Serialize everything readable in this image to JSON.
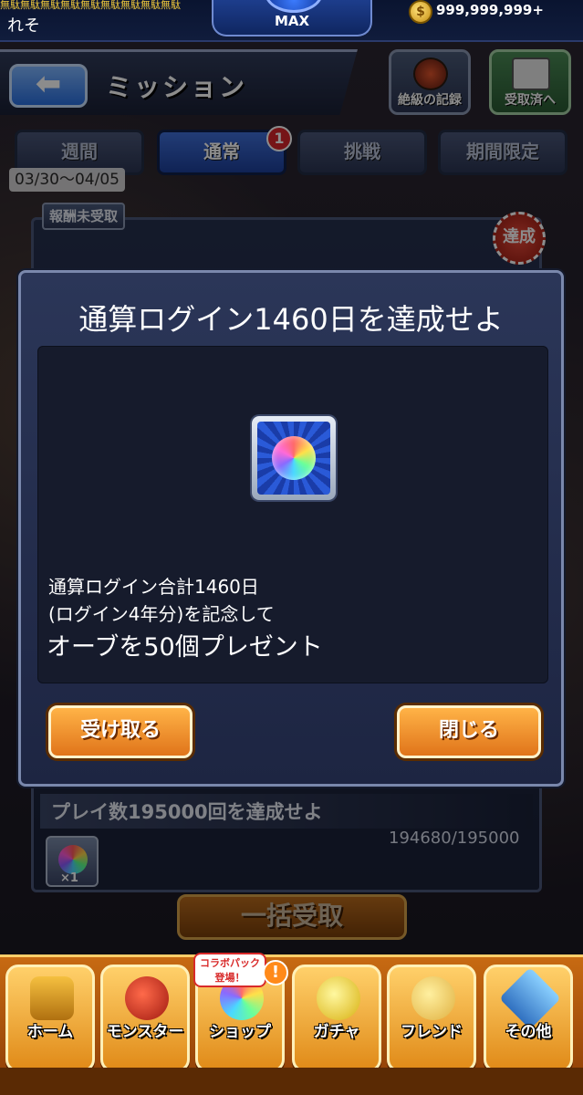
{
  "top_bar": {
    "title_strip": "無駄無駄無駄無駄無駄無駄無駄無駄無駄",
    "player_name": "れそ",
    "rank_label": "MAX",
    "coin_glyph": "$",
    "coins": "999,999,999+"
  },
  "header": {
    "back_glyph": "⬅",
    "title": "ミッション",
    "records_button": "絶級の記録",
    "received_button": "受取済へ"
  },
  "tabs": [
    {
      "label": "週間"
    },
    {
      "label": "通常",
      "badge": "1"
    },
    {
      "label": "挑戦"
    },
    {
      "label": "期間限定"
    }
  ],
  "date_range": "03/30〜04/05",
  "list": {
    "unclaimed_tag": "報酬未受取",
    "achieved_stamp": "達成",
    "mission_title": "プレイ数195000回を達成せよ",
    "mission_progress": "194680/195000",
    "reward_qty": "×1",
    "bulk_claim": "一括受取"
  },
  "modal": {
    "title": "通算ログイン1460日を達成せよ",
    "reward_icon": "rainbow-orb",
    "desc_line1": "通算ログイン合計1460日",
    "desc_line2": "(ログイン4年分)を記念して",
    "desc_line3": "オーブを50個プレゼント",
    "receive_button": "受け取る",
    "close_button": "閉じる"
  },
  "nav": {
    "items": [
      {
        "label": "ホーム"
      },
      {
        "label": "モンスター"
      },
      {
        "label": "ショップ"
      },
      {
        "label": "ガチャ"
      },
      {
        "label": "フレンド"
      },
      {
        "label": "その他"
      }
    ],
    "shop_callout": "コラボパック\n登場！",
    "shop_alert": "!"
  },
  "colors": {
    "accent_orange": "#e0741a",
    "active_tab_blue": "#3f6fd8",
    "modal_bg": "#2b3658"
  }
}
